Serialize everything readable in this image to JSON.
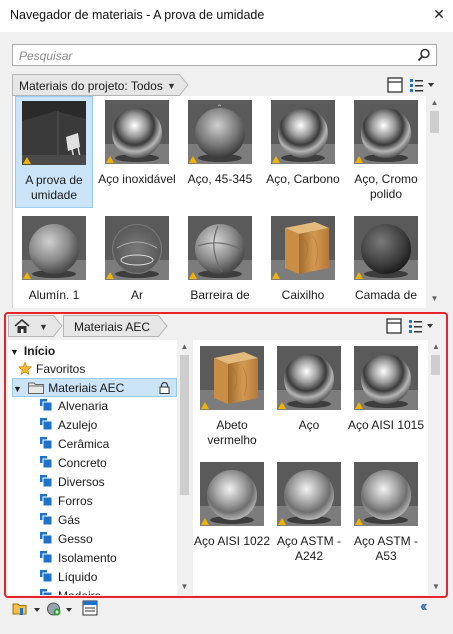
{
  "window": {
    "title": "Navegador de materiais - A prova de umidade"
  },
  "search": {
    "placeholder": "Pesquisar"
  },
  "project": {
    "breadcrumb": "Materiais do projeto: Todos",
    "materials": [
      {
        "name": "A prova de umidade",
        "kind": "wall",
        "selected": true
      },
      {
        "name": "Aço inoxidável",
        "kind": "chrome",
        "selected": false
      },
      {
        "name": "Aço, 45-345",
        "kind": "rough-metal",
        "selected": false
      },
      {
        "name": "Aço, Carbono",
        "kind": "chrome",
        "selected": false
      },
      {
        "name": "Aço, Cromo polido",
        "kind": "chrome",
        "selected": false
      },
      {
        "name": "Alumín. 1",
        "kind": "matte",
        "selected": false
      },
      {
        "name": "Ar",
        "kind": "glass",
        "selected": false
      },
      {
        "name": "Barreira de",
        "kind": "ball",
        "selected": false
      },
      {
        "name": "Caixilho",
        "kind": "wood",
        "selected": false
      },
      {
        "name": "Camada de",
        "kind": "dark",
        "selected": false
      }
    ]
  },
  "library": {
    "breadcrumb": "Materiais AEC",
    "tree": {
      "root": "Início",
      "favorites": "Favoritos",
      "library": "Materiais AEC",
      "categories": [
        "Alvenaria",
        "Azulejo",
        "Cerâmica",
        "Concreto",
        "Diversos",
        "Forros",
        "Gás",
        "Gesso",
        "Isolamento",
        "Líquido",
        "Madeira"
      ]
    },
    "materials": [
      {
        "name": "Abeto vermelho",
        "kind": "wood"
      },
      {
        "name": "Aço",
        "kind": "chrome"
      },
      {
        "name": "Aço AISI 1015",
        "kind": "chrome"
      },
      {
        "name": "Aço AISI 1022",
        "kind": "satin"
      },
      {
        "name": "Aço ASTM - A242",
        "kind": "satin"
      },
      {
        "name": "Aço ASTM - A53",
        "kind": "satin"
      }
    ]
  },
  "colors": {
    "accent": "#e8232b",
    "selection": "#cce4f7",
    "warning": "#f0b400",
    "folder": "#1e73c8"
  }
}
